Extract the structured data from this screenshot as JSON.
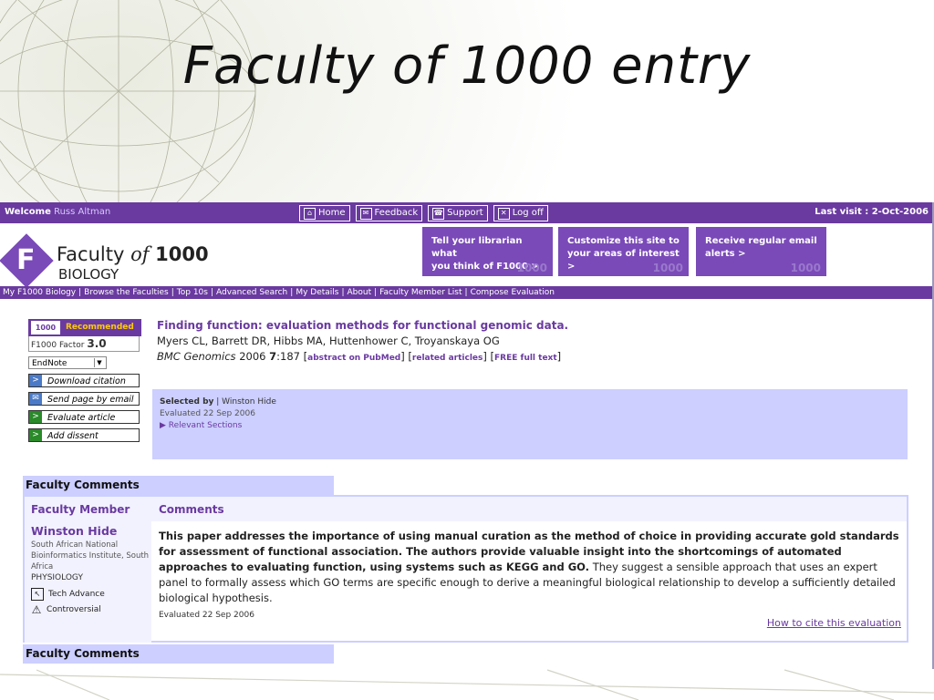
{
  "slide": {
    "title": "Faculty of 1000 entry"
  },
  "topbar": {
    "welcome_label": "Welcome",
    "user_name": "Russ Altman",
    "buttons": [
      {
        "label": "Home",
        "icon": "home-icon"
      },
      {
        "label": "Feedback",
        "icon": "mail-icon"
      },
      {
        "label": "Support",
        "icon": "support-icon"
      },
      {
        "label": "Log off",
        "icon": "close-icon"
      }
    ],
    "last_visit": "Last visit : 2-Oct-2006"
  },
  "logo": {
    "faculty": "Faculty",
    "of": "of",
    "number": "1000",
    "subtitle": "BIOLOGY"
  },
  "promos": [
    {
      "line1": "Tell your librarian what",
      "line2": "you think of F1000 >"
    },
    {
      "line1": "Customize this site to",
      "line2": "your areas of interest >"
    },
    {
      "line1": "Receive regular email",
      "line2": "alerts >"
    }
  ],
  "promo_watermark": "1000",
  "nav": [
    "My F1000 Biology",
    "Browse the Faculties",
    "Top 10s",
    "Advanced Search",
    "My Details",
    "About",
    "Faculty Member List",
    "Compose Evaluation"
  ],
  "sidebar": {
    "badge": "1000",
    "recommended": "Recommended",
    "factor_label": "F1000 Factor",
    "factor_value": "3.0",
    "export_format": "EndNote",
    "actions": [
      {
        "label": "Download citation",
        "icon": "arrow-icon",
        "color": "#4a7ac8"
      },
      {
        "label": "Send page by email",
        "icon": "mail-icon",
        "color": "#4a7ac8"
      },
      {
        "label": "Evaluate article",
        "icon": "arrow-icon",
        "color": "#2a8a2a"
      },
      {
        "label": "Add dissent",
        "icon": "arrow-icon",
        "color": "#2a8a2a"
      }
    ]
  },
  "article": {
    "title": "Finding function: evaluation methods for functional genomic data.",
    "authors": "Myers CL, Barrett DR, Hibbs MA, Huttenhower C, Troyanskaya OG",
    "journal": "BMC Genomics",
    "year": "2006",
    "volume": "7",
    "pages": ":187",
    "links": [
      "abstract on PubMed",
      "related articles",
      "FREE full text"
    ]
  },
  "selected": {
    "label": "Selected by",
    "evaluator": "Winston Hide",
    "evaluated": "Evaluated 22 Sep 2006",
    "relevant": "Relevant Sections"
  },
  "faculty_comments": {
    "heading": "Faculty Comments",
    "col_member": "Faculty Member",
    "col_comments": "Comments",
    "member": {
      "name": "Winston Hide",
      "institute": "South African National Bioinformatics Institute, South Africa",
      "department": "PHYSIOLOGY",
      "tags": [
        {
          "label": "Tech Advance",
          "icon": "tech-advance-icon"
        },
        {
          "label": "Controversial",
          "icon": "warning-icon"
        }
      ]
    },
    "comment_bold": "This paper addresses the importance of using manual curation as the method of choice in providing accurate gold standards for assessment of functional association. The authors provide valuable insight into the shortcomings of automated approaches to evaluating function, using systems such as KEGG and GO.",
    "comment_rest": " They suggest a sensible approach that uses an expert panel to formally assess which GO terms are specific enough to derive a meaningful biological relationship to develop a sufficiently detailed biological hypothesis.",
    "evaluated": "Evaluated 22 Sep 2006",
    "cite_link": "How to cite this evaluation"
  },
  "colors": {
    "purple": "#6a3aa0",
    "lavender": "#cccfff"
  }
}
